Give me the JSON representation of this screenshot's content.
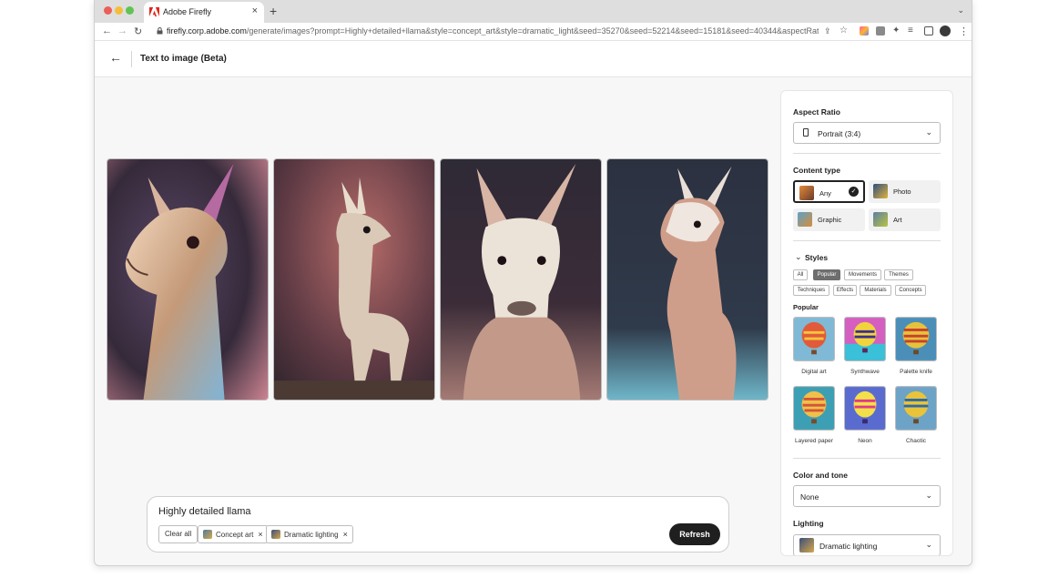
{
  "browser": {
    "tab_title": "Adobe Firefly",
    "url_host": "firefly.corp.adobe.com",
    "url_path": "/generate/images?prompt=Highly+detailed+llama&style=concept_art&style=dramatic_light&seed=35270&seed=52214&seed=15181&seed=40344&aspectRatio=portrait..."
  },
  "appbar": {
    "title": "Text to image (Beta)"
  },
  "images": [
    {
      "alt": "llama image 1"
    },
    {
      "alt": "llama image 2"
    },
    {
      "alt": "llama image 3"
    },
    {
      "alt": "llama image 4"
    }
  ],
  "prompt": {
    "text": "Highly detailed llama",
    "clear_label": "Clear all",
    "chips": [
      "Concept art",
      "Dramatic lighting"
    ],
    "refresh_label": "Refresh"
  },
  "panel": {
    "aspect_ratio_label": "Aspect Ratio",
    "aspect_ratio_value": "Portrait (3:4)",
    "content_type_label": "Content type",
    "content_types": [
      "Any",
      "Photo",
      "Graphic",
      "Art"
    ],
    "content_type_selected": "Any",
    "styles_label": "Styles",
    "style_tabs": [
      "All",
      "Popular",
      "Movements",
      "Themes",
      "Techniques",
      "Effects",
      "Materials",
      "Concepts"
    ],
    "style_tab_selected": "Popular",
    "popular_label": "Popular",
    "styles": [
      "Digital art",
      "Synthwave",
      "Palette knife",
      "Layered paper",
      "Neon",
      "Chaotic"
    ],
    "color_tone_label": "Color and tone",
    "color_tone_value": "None",
    "lighting_label": "Lighting",
    "lighting_value": "Dramatic lighting"
  },
  "colors": {
    "accent_dark": "#1f1f1f",
    "adobe_red": "#e1251b"
  }
}
